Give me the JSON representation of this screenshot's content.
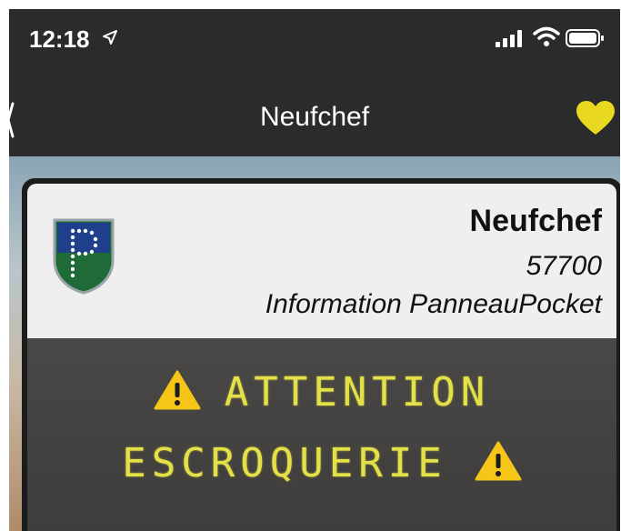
{
  "status_bar": {
    "time": "12:18",
    "icons": [
      "location-arrow-icon",
      "signal-bars-icon",
      "wifi-icon",
      "battery-icon"
    ],
    "text_color": "#ffffff"
  },
  "nav": {
    "title": "Neufchef",
    "favorite_icon": "heart-icon",
    "favorite_color": "#e8d81f",
    "back_icon": "back-icon"
  },
  "panel": {
    "title": "Neufchef",
    "postcode": "57700",
    "subtitle": "Information PanneauPocket",
    "logo_icon": "panneaupocket-shield-logo",
    "message_line_1": "ATTENTION",
    "message_line_2": "ESCROQUERIE",
    "message_color": "#e3e04a",
    "warning_icon": "warning-triangle-icon"
  },
  "colors": {
    "app_background": "#2b2b2b",
    "header_background": "#efefef",
    "message_background": "#444240"
  }
}
